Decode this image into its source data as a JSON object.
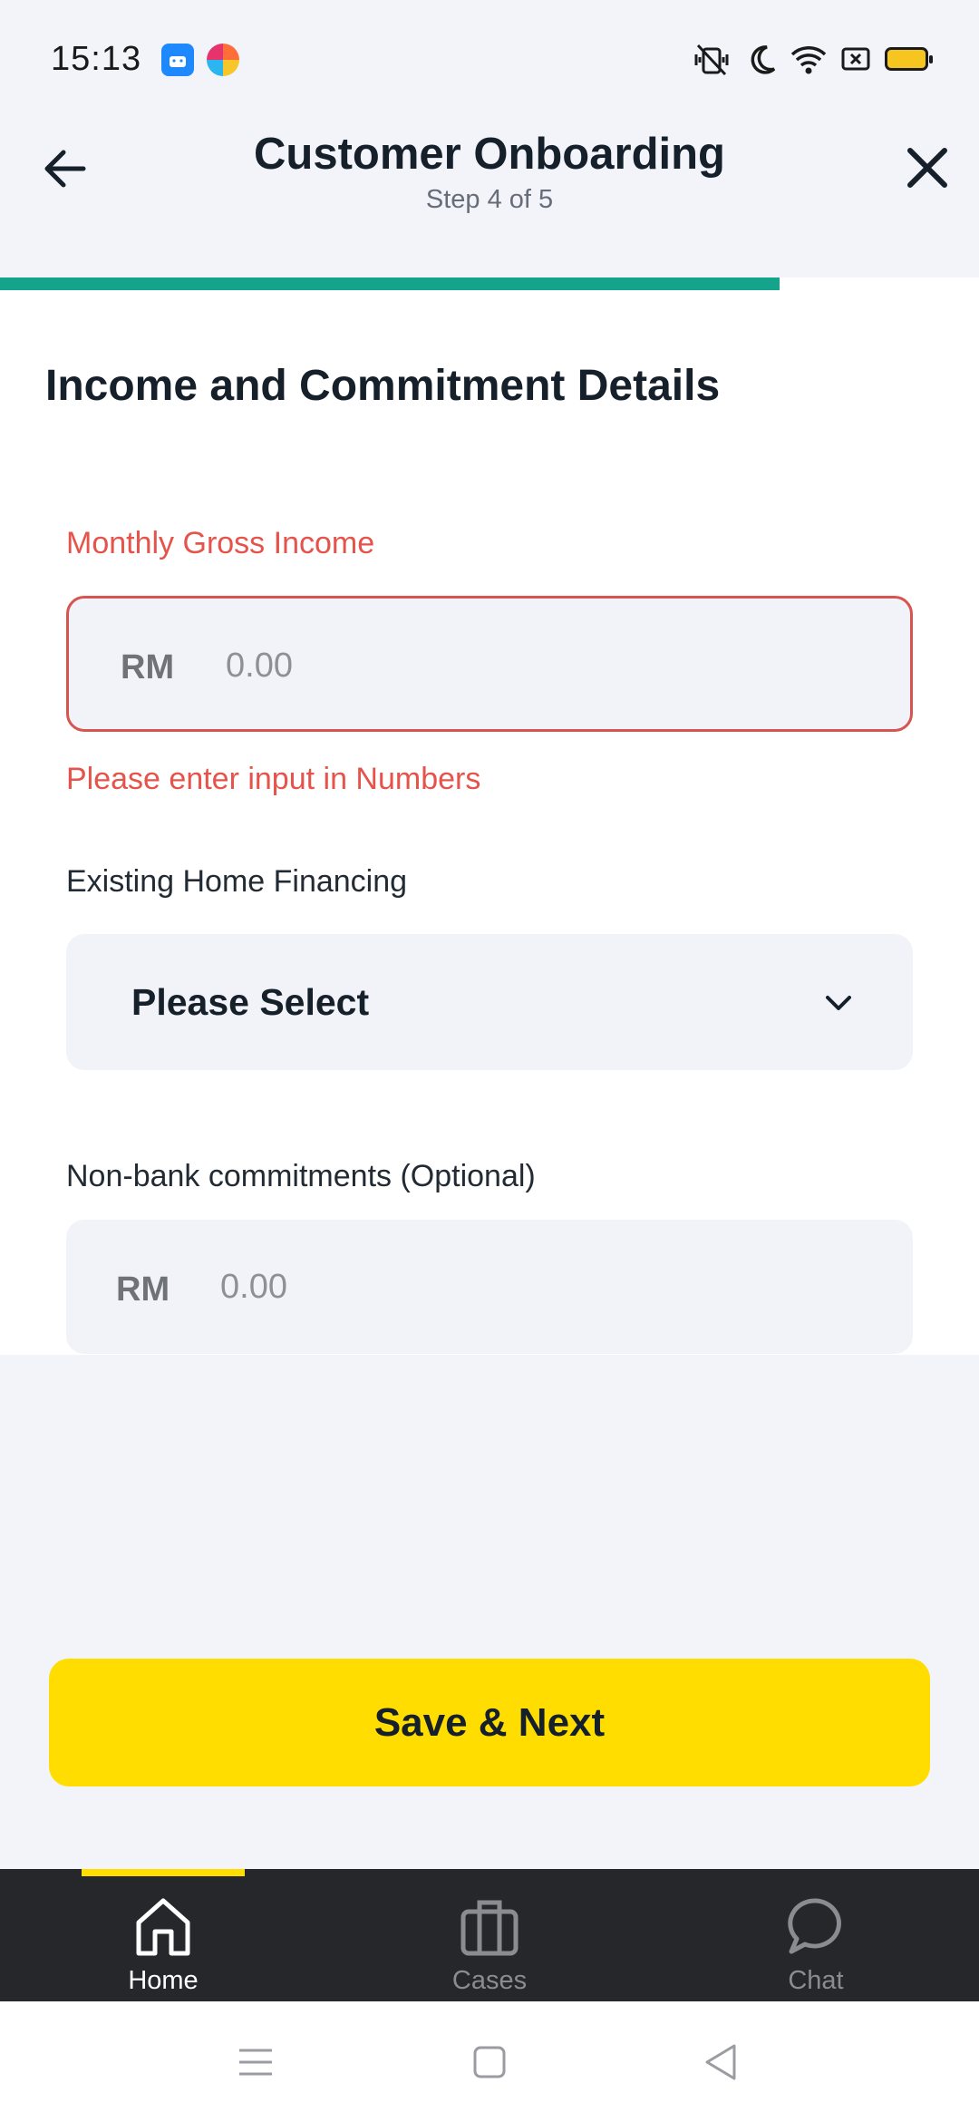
{
  "status_bar": {
    "time": "15:13",
    "icons": [
      "android-app-icon",
      "browser-app-icon",
      "vibrate-off-icon",
      "moon-icon",
      "wifi-icon",
      "screen-icon",
      "battery-icon"
    ],
    "battery_color": "#f6c520"
  },
  "header": {
    "title": "Customer Onboarding",
    "step": "Step 4 of 5",
    "back_icon": "arrow-left-icon",
    "close_icon": "close-icon"
  },
  "progress": {
    "current_step": 4,
    "total_steps": 5,
    "fraction": 0.8,
    "color": "#14a38b"
  },
  "form": {
    "section_title": "Income and Commitment Details",
    "monthly_income": {
      "label": "Monthly Gross Income",
      "prefix": "RM",
      "placeholder": "0.00",
      "error": "Please enter input in Numbers"
    },
    "home_financing": {
      "label": "Existing Home Financing",
      "selected": "Please Select"
    },
    "non_bank": {
      "label": "Non-bank commitments (Optional)",
      "prefix": "RM",
      "placeholder": "0.00"
    }
  },
  "actions": {
    "save_next": "Save & Next",
    "color": "#ffdd00"
  },
  "bottom_nav": {
    "items": [
      {
        "label": "Home",
        "icon": "home-icon",
        "active": true
      },
      {
        "label": "Cases",
        "icon": "briefcase-icon",
        "active": false
      },
      {
        "label": "Chat",
        "icon": "chat-bubble-icon",
        "active": false
      }
    ],
    "accent": "#ffdd00"
  },
  "system_nav": {
    "icons": [
      "menu-icon",
      "square-icon",
      "back-triangle-icon"
    ]
  }
}
